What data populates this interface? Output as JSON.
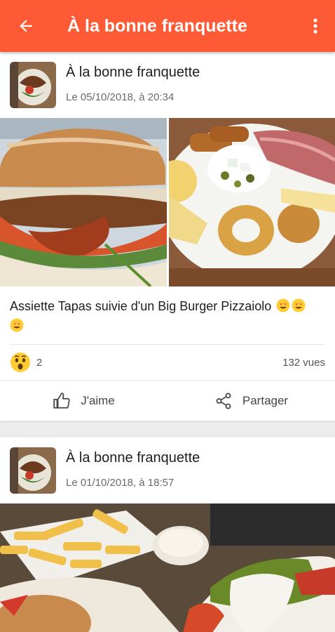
{
  "appbar": {
    "title": "À la bonne franquette",
    "back_icon": "arrow-back-icon",
    "menu_icon": "more-vertical-icon",
    "color": "#ff5a36"
  },
  "posts": [
    {
      "author": "À la bonne franquette",
      "date": "Le 05/10/2018, à 20:34",
      "caption": "Assiette Tapas suivie d'un Big Burger Pizzaiolo",
      "reaction_count": "2",
      "views": "132 vues",
      "like_label": "J'aime",
      "share_label": "Partager"
    },
    {
      "author": "À la bonne franquette",
      "date": "Le 01/10/2018, à 18:57"
    }
  ]
}
